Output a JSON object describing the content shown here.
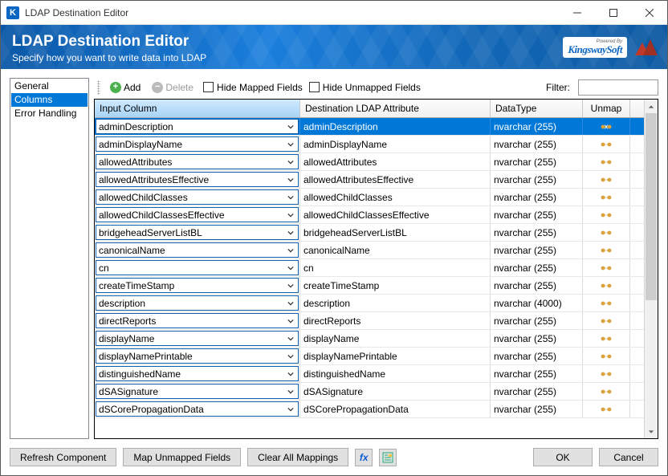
{
  "window": {
    "title": "LDAP Destination Editor"
  },
  "banner": {
    "title": "LDAP Destination Editor",
    "subtitle": "Specify how you want to write data into LDAP",
    "logo_small": "Powered By",
    "logo_big": "KingswaySoft"
  },
  "nav": {
    "items": [
      "General",
      "Columns",
      "Error Handling"
    ],
    "selected_index": 1
  },
  "toolbar": {
    "add": "Add",
    "delete": "Delete",
    "hide_mapped": "Hide Mapped Fields",
    "hide_unmapped": "Hide Unmapped Fields",
    "filter_label": "Filter:",
    "filter_value": ""
  },
  "grid": {
    "headers": {
      "input": "Input Column",
      "attr": "Destination LDAP Attribute",
      "datatype": "DataType",
      "unmap": "Unmap"
    },
    "selected_index": 0,
    "rows": [
      {
        "input": "adminDescription",
        "attr": "adminDescription",
        "datatype": "nvarchar (255)"
      },
      {
        "input": "adminDisplayName",
        "attr": "adminDisplayName",
        "datatype": "nvarchar (255)"
      },
      {
        "input": "allowedAttributes",
        "attr": "allowedAttributes",
        "datatype": "nvarchar (255)"
      },
      {
        "input": "allowedAttributesEffective",
        "attr": "allowedAttributesEffective",
        "datatype": "nvarchar (255)"
      },
      {
        "input": "allowedChildClasses",
        "attr": "allowedChildClasses",
        "datatype": "nvarchar (255)"
      },
      {
        "input": "allowedChildClassesEffective",
        "attr": "allowedChildClassesEffective",
        "datatype": "nvarchar (255)"
      },
      {
        "input": "bridgeheadServerListBL",
        "attr": "bridgeheadServerListBL",
        "datatype": "nvarchar (255)"
      },
      {
        "input": "canonicalName",
        "attr": "canonicalName",
        "datatype": "nvarchar (255)"
      },
      {
        "input": "cn",
        "attr": "cn",
        "datatype": "nvarchar (255)"
      },
      {
        "input": "createTimeStamp",
        "attr": "createTimeStamp",
        "datatype": "nvarchar (255)"
      },
      {
        "input": "description",
        "attr": "description",
        "datatype": "nvarchar (4000)"
      },
      {
        "input": "directReports",
        "attr": "directReports",
        "datatype": "nvarchar (255)"
      },
      {
        "input": "displayName",
        "attr": "displayName",
        "datatype": "nvarchar (255)"
      },
      {
        "input": "displayNamePrintable",
        "attr": "displayNamePrintable",
        "datatype": "nvarchar (255)"
      },
      {
        "input": "distinguishedName",
        "attr": "distinguishedName",
        "datatype": "nvarchar (255)"
      },
      {
        "input": "dSASignature",
        "attr": "dSASignature",
        "datatype": "nvarchar (255)"
      },
      {
        "input": "dSCorePropagationData",
        "attr": "dSCorePropagationData",
        "datatype": "nvarchar (255)"
      }
    ]
  },
  "footer": {
    "refresh": "Refresh Component",
    "map_unmapped": "Map Unmapped Fields",
    "clear": "Clear All Mappings",
    "ok": "OK",
    "cancel": "Cancel"
  }
}
